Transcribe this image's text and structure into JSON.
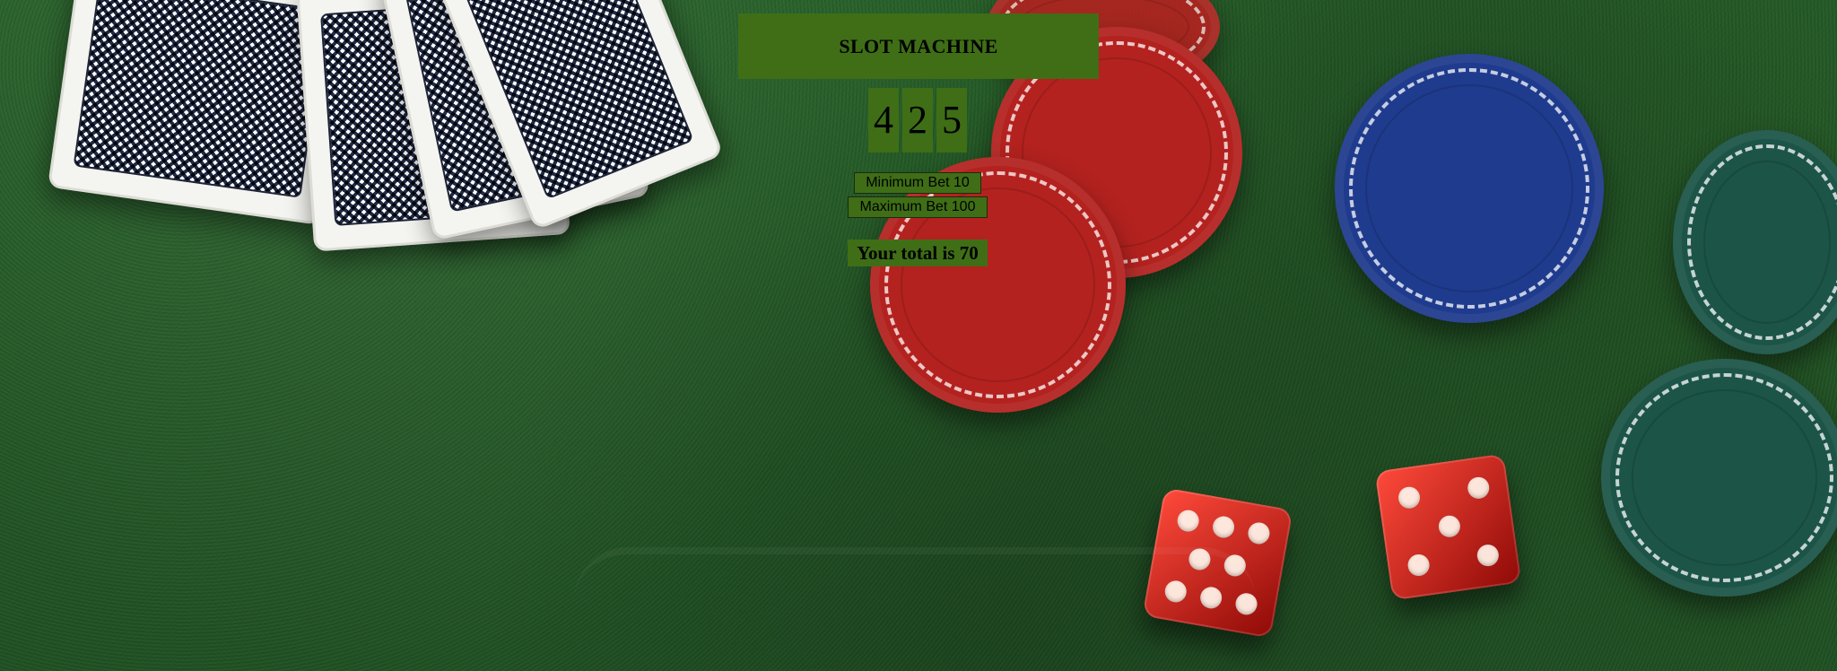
{
  "header": {
    "title": "SLOT MACHINE"
  },
  "slot": {
    "reels": [
      "4",
      "2",
      "5"
    ]
  },
  "bets": {
    "minimum": "Minimum Bet 10",
    "maximum": "Maximum Bet 100"
  },
  "status": {
    "total_text": "Your total is 70"
  },
  "colors": {
    "panel": "#3f6e16",
    "felt": "#1f5a24",
    "chip_red": "#b3221f",
    "chip_blue": "#1f3b8d",
    "chip_green": "#1c5448",
    "dice": "#d61f17"
  },
  "icons": {
    "cards": "playing-cards-icon",
    "chips": "casino-chip-icon",
    "dice": "dice-icon"
  }
}
